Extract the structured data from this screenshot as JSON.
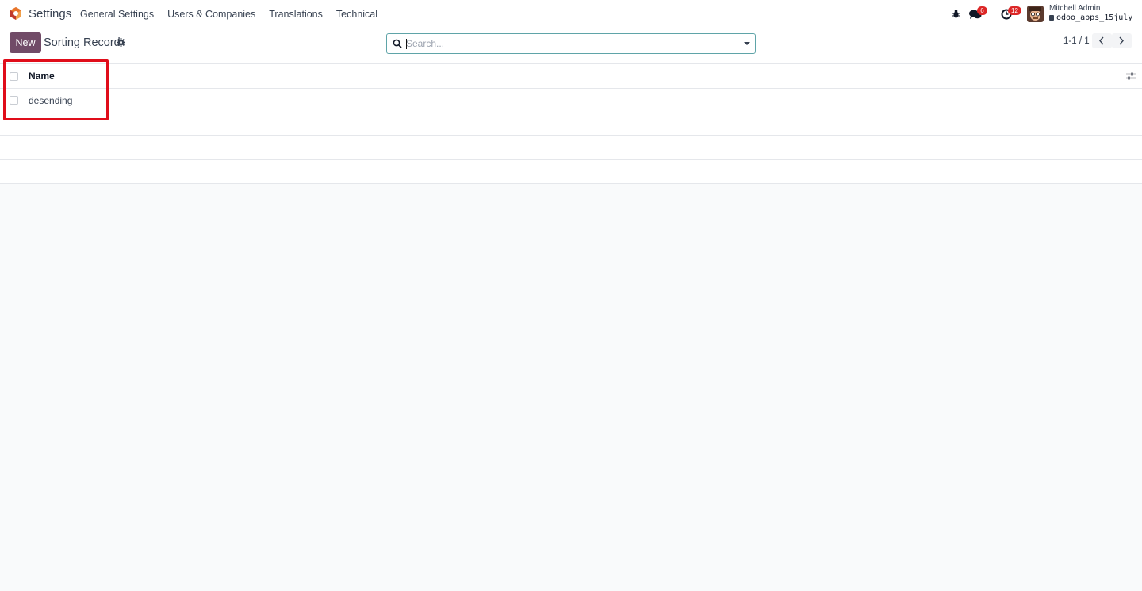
{
  "navbar": {
    "app_name": "Settings",
    "menu": [
      "General Settings",
      "Users & Companies",
      "Translations",
      "Technical"
    ],
    "chat_badge": "6",
    "activity_badge": "12",
    "user_name": "Mitchell Admin",
    "database": "odoo_apps_15july"
  },
  "control_panel": {
    "new_label": "New",
    "breadcrumb": "Sorting Record",
    "search_placeholder": "Search...",
    "pager": "1-1 / 1"
  },
  "list": {
    "columns": [
      "Name"
    ],
    "rows": [
      {
        "name": "desending"
      }
    ]
  },
  "colors": {
    "brand": "#714b67",
    "badge": "#dc2626",
    "highlight": "#e00d1a",
    "search_border": "#5fa4a8"
  }
}
